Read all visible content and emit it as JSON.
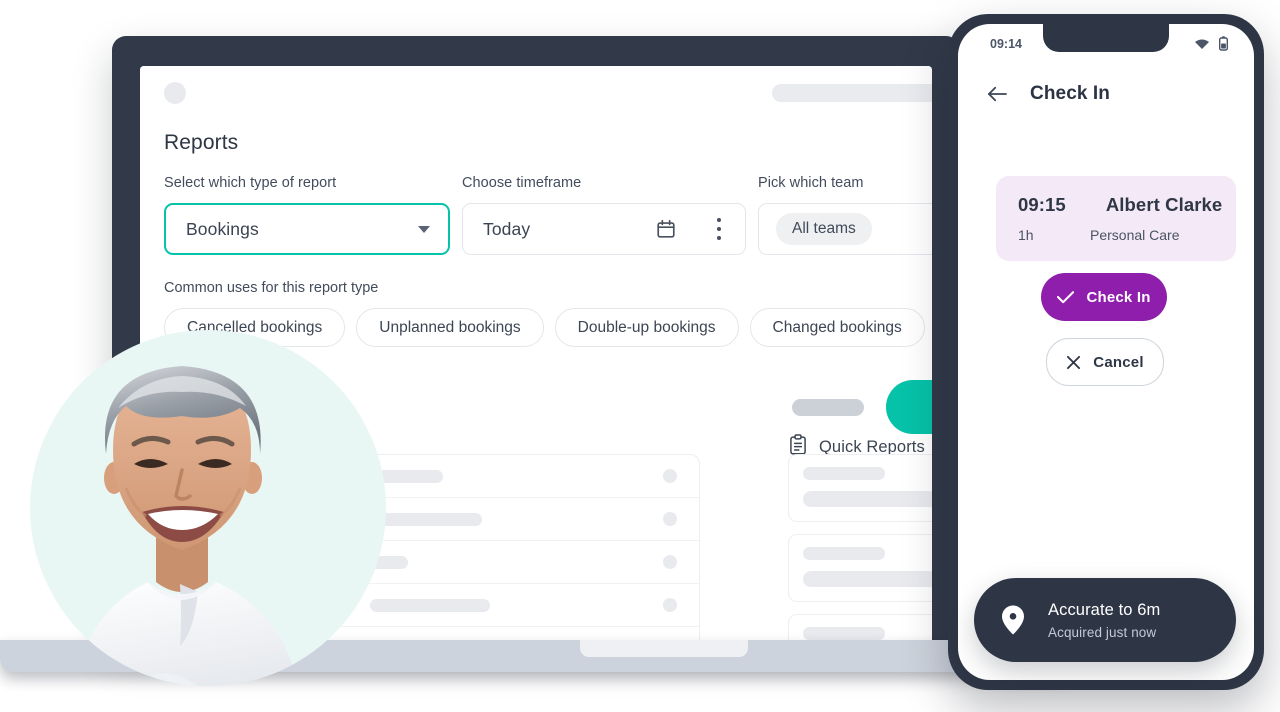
{
  "desktop": {
    "browser": {
      "dot": "window-dot",
      "pill": "address-pill"
    },
    "page_title": "Reports",
    "fields": [
      {
        "key": "report_type",
        "label": "Select which type of report",
        "value": "Bookings",
        "state": "active"
      },
      {
        "key": "timeframe",
        "label": "Choose timeframe",
        "value": "Today",
        "state": "default"
      },
      {
        "key": "team",
        "label": "Pick which team",
        "value": "All teams",
        "state": "default"
      }
    ],
    "common_uses_label": "Common uses for this report type",
    "chips": [
      "Cancelled bookings",
      "Unplanned bookings",
      "Double-up bookings",
      "Changed bookings"
    ],
    "quick_reports_title": "Quick Reports",
    "accent_teal": "#06c2a8",
    "skeleton": {
      "table_rows": 5,
      "cards": 3
    }
  },
  "phone": {
    "status_time": "09:14",
    "header_title": "Check In",
    "appointment": {
      "time": "09:15",
      "duration": "1h",
      "client": "Albert Clarke",
      "service": "Personal Care",
      "card_color": "#f4e9f6"
    },
    "primary_button": {
      "label": "Check In",
      "color": "#8e1eab"
    },
    "secondary_button": {
      "label": "Cancel"
    },
    "toast": {
      "title": "Accurate to 6m",
      "subtitle": "Acquired just now",
      "color": "#2e3646"
    }
  },
  "photo": {
    "alt": "Smiling senior woman with short grey hair wearing a white blouse",
    "circle_color": "#e8f7f3"
  }
}
